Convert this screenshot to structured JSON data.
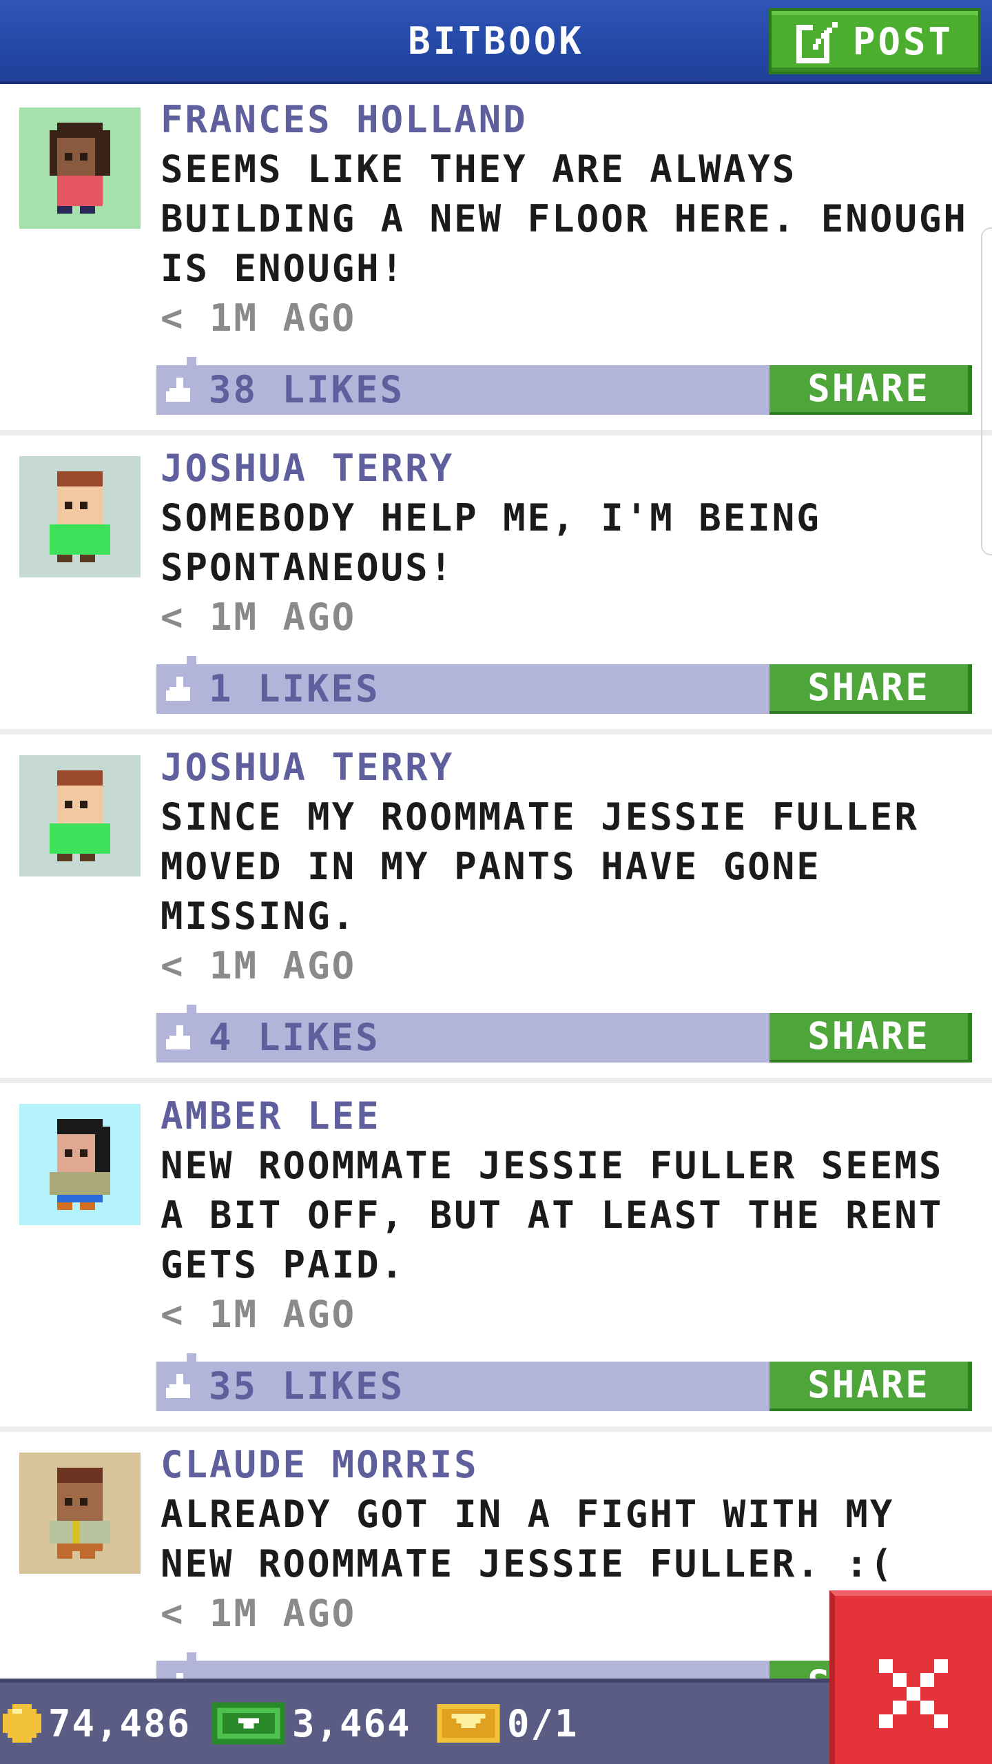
{
  "header": {
    "title": "BITBOOK",
    "post_label": "POST"
  },
  "posts": [
    {
      "author": "FRANCES HOLLAND",
      "message": "SEEMS LIKE THEY ARE ALWAYS BUILDING A NEW FLOOR HERE. ENOUGH IS ENOUGH!",
      "time": "< 1M AGO",
      "likes": "38 LIKES",
      "share": "SHARE",
      "avatar_bg": "#a6e0ad"
    },
    {
      "author": "JOSHUA TERRY",
      "message": "SOMEBODY HELP ME, I'M BEING SPONTANEOUS!",
      "time": "< 1M AGO",
      "likes": "1 LIKES",
      "share": "SHARE",
      "avatar_bg": "#c6d9d2"
    },
    {
      "author": "JOSHUA TERRY",
      "message": "SINCE MY ROOMMATE JESSIE FULLER MOVED IN MY PANTS HAVE GONE MISSING.",
      "time": "< 1M AGO",
      "likes": "4 LIKES",
      "share": "SHARE",
      "avatar_bg": "#c6d9d2"
    },
    {
      "author": "AMBER LEE",
      "message": "NEW ROOMMATE JESSIE FULLER SEEMS A BIT OFF, BUT AT LEAST THE RENT GETS PAID.",
      "time": "< 1M AGO",
      "likes": "35 LIKES",
      "share": "SHARE",
      "avatar_bg": "#b6f2fb"
    },
    {
      "author": "CLAUDE MORRIS",
      "message": "ALREADY GOT IN A FIGHT WITH MY NEW ROOMMATE JESSIE FULLER. :(",
      "time": "< 1M AGO",
      "likes": "",
      "share": "SHARE",
      "avatar_bg": "#d8c49b"
    }
  ],
  "status": {
    "coins": "74,486",
    "bux": "3,464",
    "tickets": "0/1"
  },
  "colors": {
    "header": "#2a4cae",
    "accent_green": "#4ea63a",
    "like_bar": "#b3b4d9",
    "author_text": "#5e5f9c",
    "close_red": "#e5333a",
    "bottom_bar": "#5b5c83"
  },
  "icons": {
    "post": "edit-icon",
    "like": "thumbs-up-icon",
    "coin": "coin-icon",
    "bux": "bux-icon",
    "ticket": "ticket-icon",
    "close": "close-icon"
  }
}
